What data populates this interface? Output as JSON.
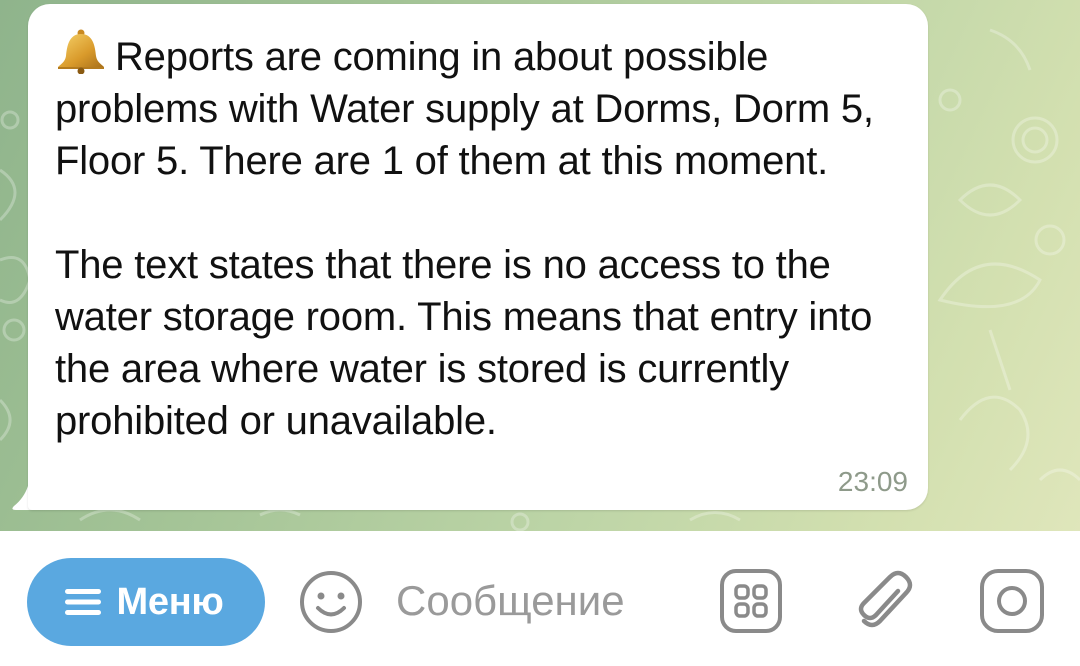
{
  "message": {
    "icon": "bell-icon",
    "paragraph_1": "Reports are coming in about possible problems with Water supply at Dorms, Dorm 5, Floor 5. There are 1 of them at this moment.",
    "paragraph_2": "The text states that there is no access to the water storage room. This means that entry into the area where water is stored is currently prohibited or unavailable.",
    "time": "23:09"
  },
  "input_bar": {
    "menu_label": "Меню",
    "menu_icon": "burger-menu-icon",
    "emoji_icon": "smile-icon",
    "placeholder": "Сообщение",
    "value": "",
    "commands_icon": "bot-commands-icon",
    "attach_icon": "paperclip-icon",
    "camera_icon": "camera-icon"
  },
  "colors": {
    "accent": "#5aa8e0",
    "bubble": "#ffffff",
    "icon_gray": "#8a8a8a",
    "time_gray": "#8e9a8a"
  }
}
